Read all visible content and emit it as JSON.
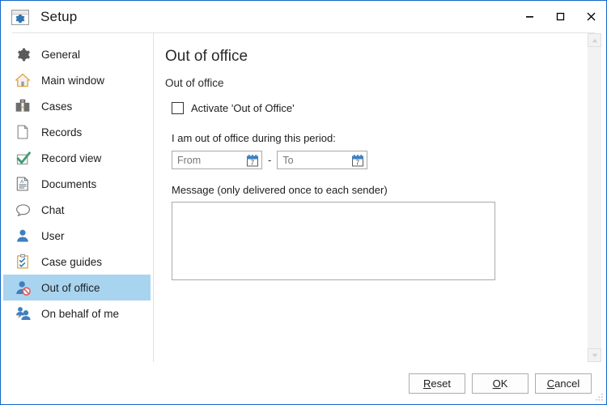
{
  "window": {
    "title": "Setup",
    "icon": "setup-gear-icon",
    "controls": {
      "minimize": "–",
      "maximize": "❐",
      "close": "✕"
    },
    "border_color": "#1268c8"
  },
  "sidebar": {
    "selected_index": 9,
    "selection_color": "#a8d4f0",
    "items": [
      {
        "label": "General",
        "icon": "gear-icon"
      },
      {
        "label": "Main window",
        "icon": "home-icon"
      },
      {
        "label": "Cases",
        "icon": "briefcase-icon"
      },
      {
        "label": "Records",
        "icon": "page-icon"
      },
      {
        "label": "Record view",
        "icon": "checkmark-box-icon"
      },
      {
        "label": "Documents",
        "icon": "document-text-icon"
      },
      {
        "label": "Chat",
        "icon": "speech-bubble-icon"
      },
      {
        "label": "User",
        "icon": "person-icon"
      },
      {
        "label": "Case guides",
        "icon": "clipboard-check-icon"
      },
      {
        "label": "Out of office",
        "icon": "person-blocked-icon"
      },
      {
        "label": "On behalf of me",
        "icon": "people-group-icon"
      }
    ]
  },
  "main": {
    "page_title": "Out of office",
    "section_title": "Out of office",
    "activate": {
      "label": "Activate 'Out of Office'",
      "checked": false
    },
    "period": {
      "label": "I am out of office during this period:",
      "from": {
        "value": "",
        "placeholder": "From",
        "icon": "calendar-icon"
      },
      "separator": "-",
      "to": {
        "value": "",
        "placeholder": "To",
        "icon": "calendar-icon"
      }
    },
    "message": {
      "label": "Message (only delivered once to each sender)",
      "value": "",
      "placeholder": ""
    },
    "scrollbar": {
      "up": "scroll-up-arrow-icon",
      "down": "scroll-down-arrow-icon"
    }
  },
  "footer": {
    "buttons": [
      {
        "label": "Reset",
        "accel": "R",
        "before": "",
        "after": "eset"
      },
      {
        "label": "OK",
        "accel": "O",
        "before": "",
        "after": "K"
      },
      {
        "label": "Cancel",
        "accel": "C",
        "before": "",
        "after": "ancel"
      }
    ]
  }
}
